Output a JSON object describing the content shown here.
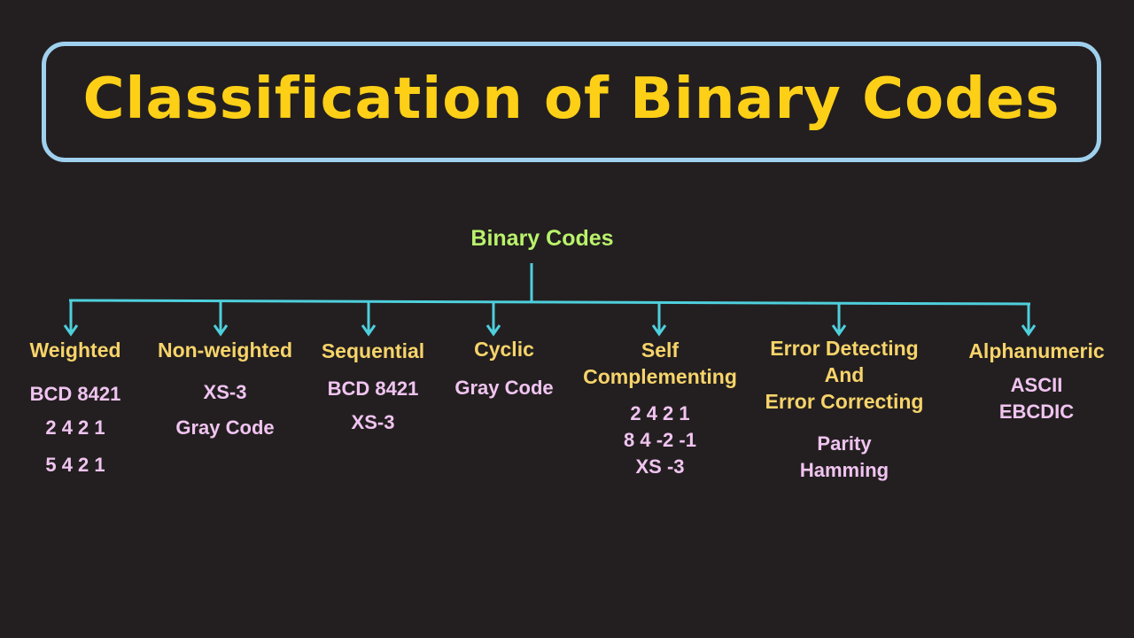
{
  "title": "Classification of Binary Codes",
  "root": "Binary Codes",
  "colors": {
    "background": "#231f20",
    "title_text": "#fdd017",
    "title_border": "#9fd0ee",
    "root_text": "#b9f26b",
    "category_text": "#f7d46a",
    "example_text": "#f0c4f0",
    "connector": "#4ecfdc"
  },
  "branches": [
    {
      "category": [
        "Weighted"
      ],
      "examples": [
        "BCD 8421",
        "2 4 2 1",
        "5 4 2 1"
      ]
    },
    {
      "category": [
        "Non-weighted"
      ],
      "examples": [
        "XS-3",
        "Gray Code"
      ]
    },
    {
      "category": [
        "Sequential"
      ],
      "examples": [
        "BCD 8421",
        "XS-3"
      ]
    },
    {
      "category": [
        "Cyclic"
      ],
      "examples": [
        "Gray Code"
      ]
    },
    {
      "category": [
        "Self",
        "Complementing"
      ],
      "examples": [
        "2 4 2 1",
        "8 4 -2 -1",
        "XS -3"
      ]
    },
    {
      "category": [
        "Error Detecting",
        "And",
        "Error Correcting"
      ],
      "examples": [
        "Parity",
        "Hamming"
      ]
    },
    {
      "category": [
        "Alphanumeric"
      ],
      "examples": [
        "ASCII",
        "EBCDIC"
      ]
    }
  ]
}
